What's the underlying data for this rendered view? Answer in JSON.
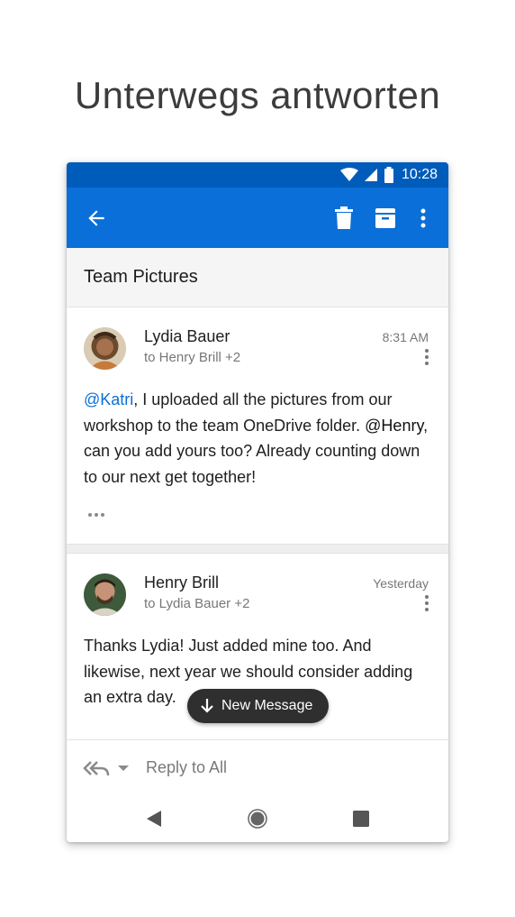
{
  "headline": "Unterwegs antworten",
  "status": {
    "time": "10:28"
  },
  "appbar": {
    "icons": [
      "back-arrow-icon",
      "delete-icon",
      "archive-icon",
      "more-vert-icon"
    ]
  },
  "thread": {
    "subject": "Team Pictures"
  },
  "messages": [
    {
      "sender": "Lydia Bauer",
      "recipients": "to Henry Brill +2",
      "time": "8:31 AM",
      "mention": "@Katri",
      "body_1": ", I uploaded all the pictures from our workshop to the team OneDrive folder. ",
      "mention_2": "@Henry",
      "body_2": ", can you add yours too? Already counting down to our next get together!"
    },
    {
      "sender": "Henry Brill",
      "recipients": "to Lydia Bauer +2",
      "time": "Yesterday",
      "body": "Thanks Lydia! Just added mine too. And likewise, next year we should consider adding an extra day."
    }
  ],
  "new_message": {
    "label": "New Message"
  },
  "reply": {
    "label": "Reply to All"
  },
  "colors": {
    "status_bar": "#005cbb",
    "app_bar": "#0a6fd8",
    "mention": "#0a6fd8",
    "pill": "#2f2f2f"
  }
}
